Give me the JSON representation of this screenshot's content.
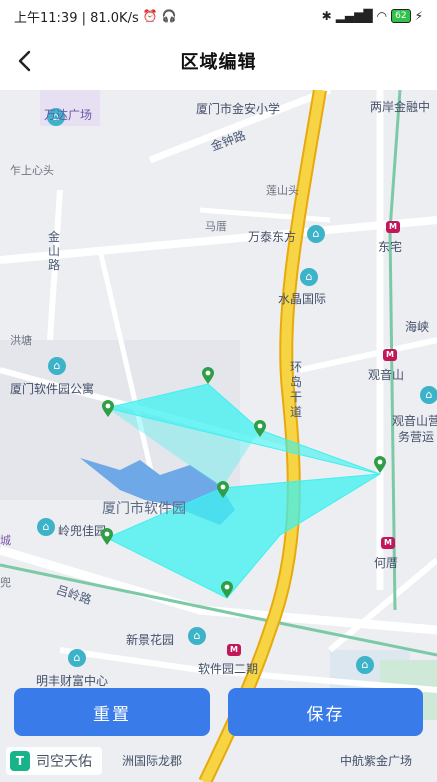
{
  "status_bar": {
    "time_speed": "上午11:39 | 81.0K/s",
    "battery": "62"
  },
  "header": {
    "title": "区域编辑"
  },
  "map": {
    "labels": {
      "wanda": "万达广场",
      "jinan_school": "厦门市金安小学",
      "liangan": "两岸金融中",
      "jinzhong_road": "金钟路",
      "zuoshang": "乍上心头",
      "lianshantou": "莲山头",
      "jinshan_road": "金山路",
      "mashan": "马厝",
      "wantai": "万泰东方",
      "dongzhai": "东宅",
      "shuijing": "水晶国际",
      "haixia": "海峡",
      "hongtang": "洪塘",
      "guanyinshan": "观音山",
      "software_apartment": "厦门软件园公寓",
      "huandao_road": "环岛干道",
      "guanyinshan_yunying": "观音山营",
      "yunying_line2": "务营运",
      "software_park": "厦门市软件园",
      "lingdou": "岭兜佳园",
      "cheng": "城",
      "hecuo": "何厝",
      "doubao": "兜",
      "lvling_road": "吕岭路",
      "xinjing": "新景花园",
      "software_phase2": "软件园二期",
      "mingfeng": "明丰财富中心",
      "zhonghang": "中航紫金广场",
      "zhouguoji": "洲国际龙郡"
    }
  },
  "buttons": {
    "reset": "重置",
    "save": "保存"
  },
  "logo": {
    "mark": "T",
    "text": "司空天佑"
  },
  "colors": {
    "primary": "#3a7bea",
    "polygon_fill": "#3ef0f0",
    "pin": "#2e9e47",
    "highway": "#f5c518"
  }
}
